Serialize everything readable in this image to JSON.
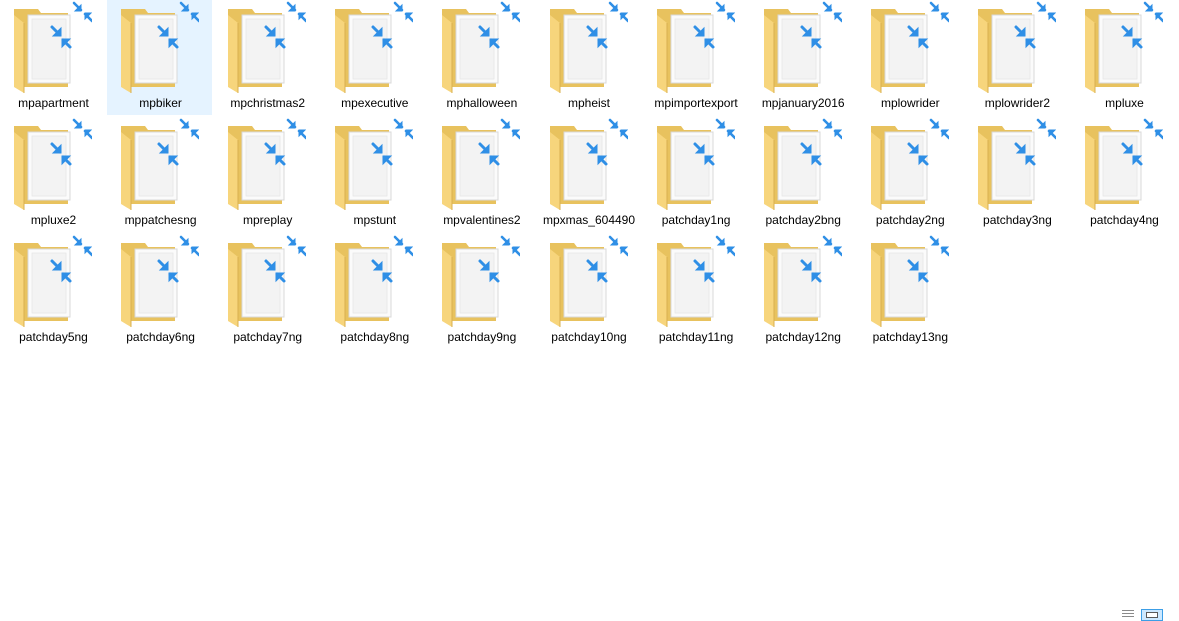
{
  "folders": [
    {
      "name": "mpapartment",
      "selected": false
    },
    {
      "name": "mpbiker",
      "selected": true
    },
    {
      "name": "mpchristmas2",
      "selected": false
    },
    {
      "name": "mpexecutive",
      "selected": false
    },
    {
      "name": "mphalloween",
      "selected": false
    },
    {
      "name": "mpheist",
      "selected": false
    },
    {
      "name": "mpimportexport",
      "selected": false
    },
    {
      "name": "mpjanuary2016",
      "selected": false
    },
    {
      "name": "mplowrider",
      "selected": false
    },
    {
      "name": "mplowrider2",
      "selected": false
    },
    {
      "name": "mpluxe",
      "selected": false
    },
    {
      "name": "mpluxe2",
      "selected": false
    },
    {
      "name": "mppatchesng",
      "selected": false
    },
    {
      "name": "mpreplay",
      "selected": false
    },
    {
      "name": "mpstunt",
      "selected": false
    },
    {
      "name": "mpvalentines2",
      "selected": false
    },
    {
      "name": "mpxmas_604490",
      "selected": false
    },
    {
      "name": "patchday1ng",
      "selected": false
    },
    {
      "name": "patchday2bng",
      "selected": false
    },
    {
      "name": "patchday2ng",
      "selected": false
    },
    {
      "name": "patchday3ng",
      "selected": false
    },
    {
      "name": "patchday4ng",
      "selected": false
    },
    {
      "name": "patchday5ng",
      "selected": false
    },
    {
      "name": "patchday6ng",
      "selected": false
    },
    {
      "name": "patchday7ng",
      "selected": false
    },
    {
      "name": "patchday8ng",
      "selected": false
    },
    {
      "name": "patchday9ng",
      "selected": false
    },
    {
      "name": "patchday10ng",
      "selected": false
    },
    {
      "name": "patchday11ng",
      "selected": false
    },
    {
      "name": "patchday12ng",
      "selected": false
    },
    {
      "name": "patchday13ng",
      "selected": false
    }
  ],
  "icons": {
    "folder": "folder-icon",
    "compressed_overlay": "compressed-arrows-overlay-icon"
  },
  "colors": {
    "folder_back": "#e8c25e",
    "folder_front": "#f7d57c",
    "paper": "#fbfbfb",
    "overlay_arrows": "#2f8fe6",
    "selection": "#e5f3ff",
    "label_text": "#000000"
  },
  "view_mode": {
    "active": "large-icons",
    "options": [
      "details",
      "large-icons"
    ]
  }
}
